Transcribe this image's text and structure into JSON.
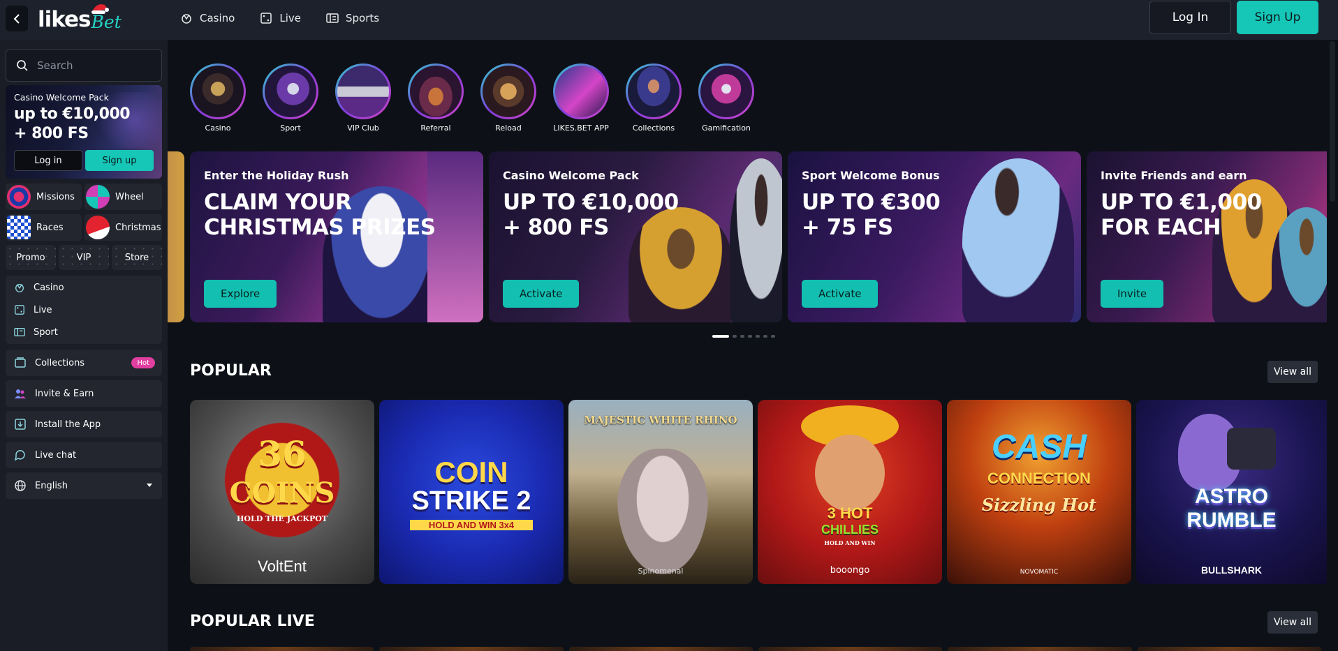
{
  "header": {
    "logo_likes": "likes",
    "logo_bet": "Bet",
    "nav": [
      {
        "label": "Casino",
        "icon": "roulette-icon"
      },
      {
        "label": "Live",
        "icon": "live-dice-icon"
      },
      {
        "label": "Sports",
        "icon": "ticket-icon"
      }
    ],
    "login_label": "Log In",
    "signup_label": "Sign Up"
  },
  "sidebar": {
    "search_placeholder": "Search",
    "promo": {
      "title": "Casino Welcome Pack",
      "amount_line1": "up to €10,000",
      "amount_line2": "+ 800 FS",
      "login_label": "Log in",
      "signup_label": "Sign up"
    },
    "tiles": [
      {
        "label": "Missions",
        "icon": "target-icon"
      },
      {
        "label": "Wheel",
        "icon": "wheel-icon"
      },
      {
        "label": "Races",
        "icon": "race-flag-icon"
      },
      {
        "label": "Christmas",
        "icon": "santa-hat-icon"
      }
    ],
    "chips": [
      "Promo",
      "VIP",
      "Store"
    ],
    "menu": [
      {
        "label": "Casino",
        "icon": "roulette-icon"
      },
      {
        "label": "Live",
        "icon": "live-dice-icon"
      },
      {
        "label": "Sport",
        "icon": "ticket-icon"
      }
    ],
    "collections_label": "Collections",
    "hot_badge": "Hot",
    "invite_label": "Invite & Earn",
    "install_label": "Install the App",
    "chat_label": "Live chat",
    "language": "English"
  },
  "categories": [
    {
      "label": "Casino"
    },
    {
      "label": "Sport"
    },
    {
      "label": "VIP Club"
    },
    {
      "label": "Referral"
    },
    {
      "label": "Reload"
    },
    {
      "label": "LIKES.BET APP"
    },
    {
      "label": "Collections"
    },
    {
      "label": "Gamification"
    }
  ],
  "banners": [
    {
      "subtitle": "Enter the Holiday Rush",
      "headline_1": "CLAIM YOUR",
      "headline_2": "CHRISTMAS PRIZES",
      "button": "Explore"
    },
    {
      "subtitle": "Casino Welcome Pack",
      "headline_1": "UP TO €10,000",
      "headline_2": "+ 800 FS",
      "button": "Activate"
    },
    {
      "subtitle": "Sport Welcome Bonus",
      "headline_1": "UP TO €300",
      "headline_2": "+ 75 FS",
      "button": "Activate"
    },
    {
      "subtitle": "Invite Friends and earn",
      "headline_1": "UP TO €1,000",
      "headline_2": "FOR EACH",
      "button": "Invite"
    }
  ],
  "pager": {
    "count": 7,
    "active": 0
  },
  "popular": {
    "title": "POPULAR",
    "view_all": "View all",
    "games": [
      {
        "title_1": "36",
        "title_2": "COINS",
        "title_3": "HOLD THE JACKPOT",
        "provider": "VoltEnt"
      },
      {
        "title_1": "COIN",
        "title_2": "STRIKE 2",
        "title_3": "HOLD AND WIN 3x4",
        "provider": ""
      },
      {
        "title_1": "MAJESTIC WHITE RHINO",
        "title_2": "",
        "title_3": "",
        "provider": "Spinomenal"
      },
      {
        "title_1": "3 HOT",
        "title_2": "CHILLIES",
        "title_3": "HOLD AND WIN",
        "provider": "booongo"
      },
      {
        "title_1": "CASH",
        "title_2": "CONNECTION",
        "title_3": "Sizzling Hot",
        "provider": "NOVOMATIC"
      },
      {
        "title_1": "ASTRO",
        "title_2": "RUMBLE",
        "title_3": "",
        "provider": "BULLSHARK"
      }
    ]
  },
  "popular_live": {
    "title": "POPULAR LIVE",
    "view_all": "View all"
  }
}
